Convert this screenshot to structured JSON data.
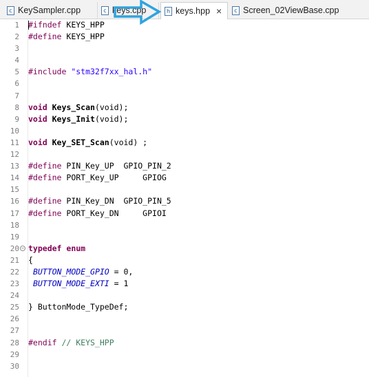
{
  "tabs": [
    {
      "label": "KeySampler.cpp",
      "icon": "c",
      "active": false
    },
    {
      "label": "keys.cpp",
      "icon": "c",
      "active": false
    },
    {
      "label": "keys.hpp",
      "icon": "h",
      "active": true,
      "close": "×"
    },
    {
      "label": "Screen_02ViewBase.cpp",
      "icon": "c",
      "active": false
    }
  ],
  "editor": {
    "lines": [
      {
        "n": "1",
        "parts": [
          [
            "dir",
            "#ifndef "
          ],
          [
            "txt",
            "KEYS_HPP"
          ]
        ]
      },
      {
        "n": "2",
        "parts": [
          [
            "dir",
            "#define "
          ],
          [
            "txt",
            "KEYS_HPP"
          ]
        ]
      },
      {
        "n": "3",
        "parts": []
      },
      {
        "n": "4",
        "parts": []
      },
      {
        "n": "5",
        "parts": [
          [
            "dir",
            "#include "
          ],
          [
            "str",
            "\"stm32f7xx_hal.h\""
          ]
        ]
      },
      {
        "n": "6",
        "parts": []
      },
      {
        "n": "7",
        "parts": []
      },
      {
        "n": "8",
        "parts": [
          [
            "kw",
            "void "
          ],
          [
            "fn",
            "Keys_Scan"
          ],
          [
            "txt",
            "(void);"
          ]
        ]
      },
      {
        "n": "9",
        "parts": [
          [
            "kw",
            "void "
          ],
          [
            "fn",
            "Keys_Init"
          ],
          [
            "txt",
            "(void);"
          ]
        ]
      },
      {
        "n": "10",
        "parts": []
      },
      {
        "n": "11",
        "parts": [
          [
            "kw",
            "void "
          ],
          [
            "fn",
            "Key_SET_Scan"
          ],
          [
            "txt",
            "(void) ;"
          ]
        ]
      },
      {
        "n": "12",
        "parts": []
      },
      {
        "n": "13",
        "parts": [
          [
            "dir",
            "#define "
          ],
          [
            "txt",
            "PIN_Key_UP  GPIO_PIN_2"
          ]
        ]
      },
      {
        "n": "14",
        "parts": [
          [
            "dir",
            "#define "
          ],
          [
            "txt",
            "PORT_Key_UP     GPIOG"
          ]
        ]
      },
      {
        "n": "15",
        "parts": []
      },
      {
        "n": "16",
        "parts": [
          [
            "dir",
            "#define "
          ],
          [
            "txt",
            "PIN_Key_DN  GPIO_PIN_5"
          ]
        ]
      },
      {
        "n": "17",
        "parts": [
          [
            "dir",
            "#define "
          ],
          [
            "txt",
            "PORT_Key_DN     GPIOI"
          ]
        ]
      },
      {
        "n": "18",
        "parts": []
      },
      {
        "n": "19",
        "parts": []
      },
      {
        "n": "20",
        "parts": [
          [
            "kw",
            "typedef "
          ],
          [
            "kw",
            "enum"
          ]
        ],
        "fold": true
      },
      {
        "n": "21",
        "parts": [
          [
            "txt",
            "{"
          ]
        ]
      },
      {
        "n": "22",
        "parts": [
          [
            "txt",
            " "
          ],
          [
            "en",
            "BUTTON_MODE_GPIO"
          ],
          [
            "txt",
            " = 0,"
          ]
        ]
      },
      {
        "n": "23",
        "parts": [
          [
            "txt",
            " "
          ],
          [
            "en",
            "BUTTON_MODE_EXTI"
          ],
          [
            "txt",
            " = 1"
          ]
        ]
      },
      {
        "n": "24",
        "parts": []
      },
      {
        "n": "25",
        "parts": [
          [
            "txt",
            "} ButtonMode_TypeDef;"
          ]
        ]
      },
      {
        "n": "26",
        "parts": []
      },
      {
        "n": "27",
        "parts": []
      },
      {
        "n": "28",
        "parts": [
          [
            "dir",
            "#endif "
          ],
          [
            "cm",
            "// KEYS_HPP"
          ]
        ]
      },
      {
        "n": "29",
        "parts": []
      },
      {
        "n": "30",
        "parts": []
      }
    ]
  },
  "colors": {
    "arrow": "#2fa3df",
    "directive": "#7f0055",
    "string": "#2a00ff",
    "enum": "#0000c0",
    "comment": "#3f7f5f"
  }
}
